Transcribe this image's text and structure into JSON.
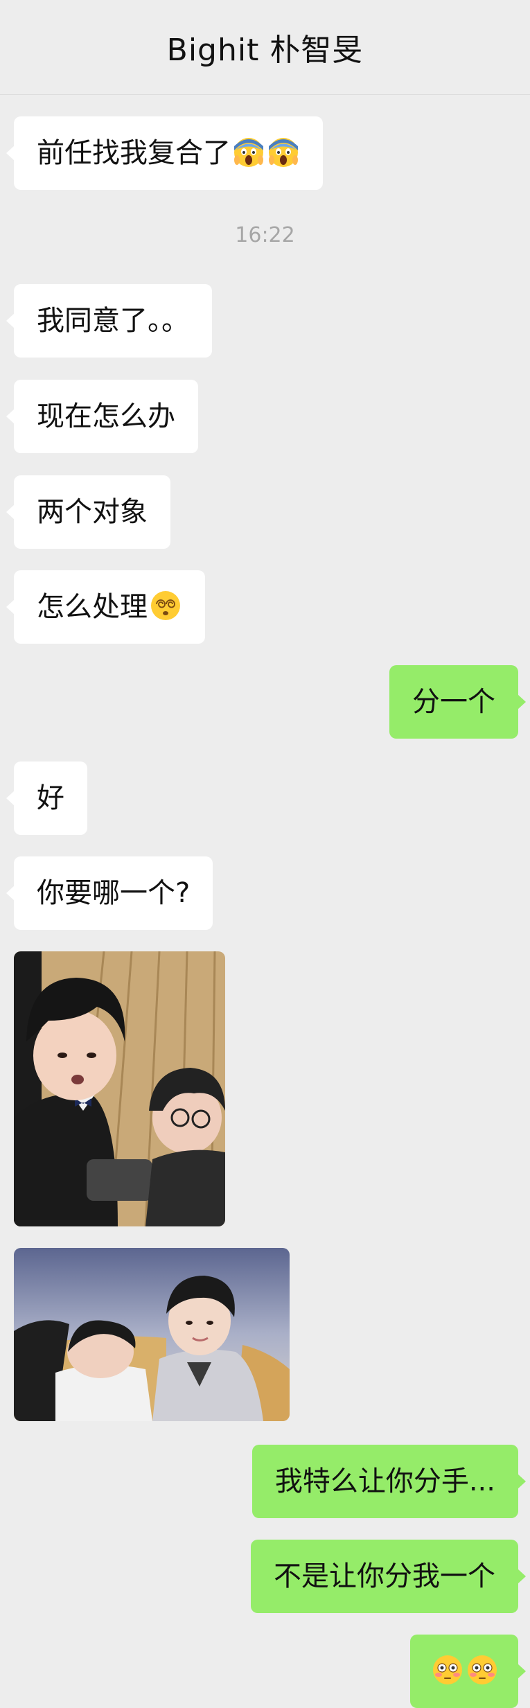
{
  "header": {
    "title": "Bighit 朴智旻"
  },
  "timestamp": "16:22",
  "messages": {
    "m1": "前任找我复合了",
    "m2": "我同意了。。",
    "m3": "现在怎么办",
    "m4": "两个对象",
    "m5": "怎么处理",
    "m6": "分一个",
    "m7": "好",
    "m8": "你要哪一个?",
    "m9": "我特么让你分手...",
    "m10": "不是让你分我一个"
  },
  "emoji_icons": {
    "m1": [
      "screaming-face",
      "screaming-face"
    ],
    "m5": [
      "dizzy-face"
    ],
    "m11": [
      "flushed-face",
      "flushed-face"
    ]
  },
  "photos": [
    {
      "icon": "photo-two-people-selfie"
    },
    {
      "icon": "photo-two-people-sofa"
    }
  ],
  "colors": {
    "background": "#ededed",
    "incoming_bubble": "#ffffff",
    "outgoing_bubble": "#95ec69",
    "timestamp_text": "#a6a6a6"
  }
}
